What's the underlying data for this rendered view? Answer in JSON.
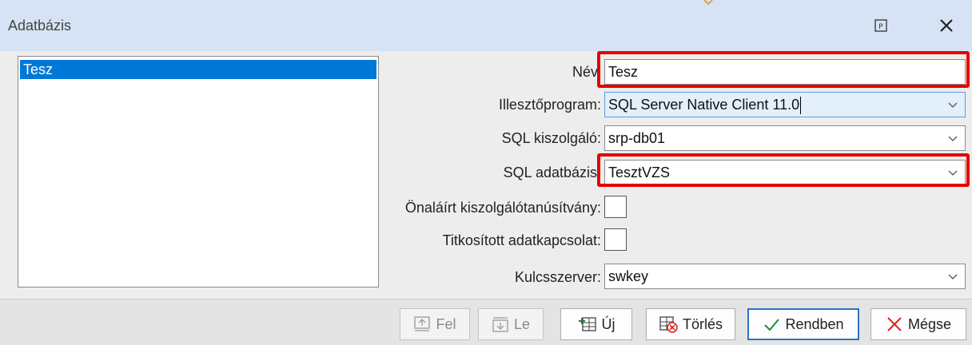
{
  "window": {
    "title": "Adatbázis"
  },
  "list": {
    "items": [
      "Tesz"
    ]
  },
  "form": {
    "name_label": "Név",
    "name_value": "Tesz",
    "driver_label": "Illesztőprogram:",
    "driver_value": "SQL Server Native Client 11.0",
    "server_label": "SQL kiszolgáló:",
    "server_value": "srp-db01",
    "database_label": "SQL adatbázis:",
    "database_value": "TesztVZS",
    "selfsigned_label": "Önaláírt kiszolgálótanúsítvány:",
    "selfsigned_checked": false,
    "encrypted_label": "Titkosított adatkapcsolat:",
    "encrypted_checked": false,
    "keyserver_label": "Kulcsszerver:",
    "keyserver_value": "swkey"
  },
  "buttons": {
    "up": "Fel",
    "down": "Le",
    "new": "Új",
    "delete": "Törlés",
    "ok": "Rendben",
    "cancel": "Mégse"
  },
  "colors": {
    "titlebar": "#d5e3f4",
    "selection": "#0078d7",
    "highlight": "#e60000",
    "accent_border": "#2a73c5"
  }
}
